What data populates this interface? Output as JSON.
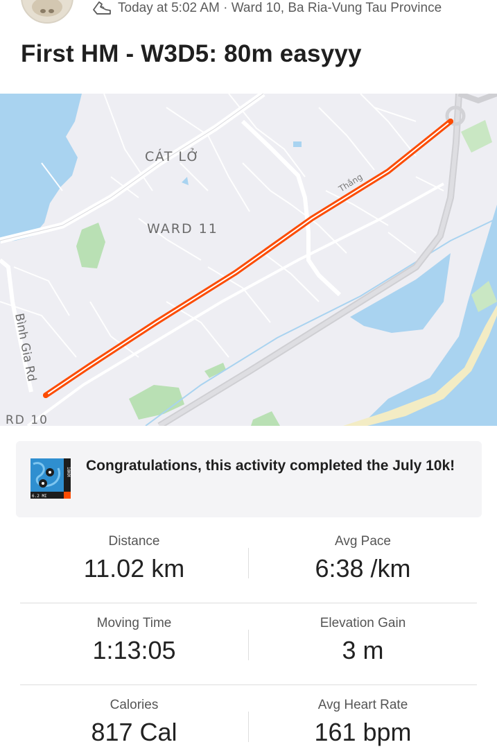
{
  "header": {
    "meta": "Today at 5:02 AM · Ward 10, Ba Ria-Vung Tau Province",
    "title": "First HM - W3D5: 80m easyyy"
  },
  "map": {
    "labels": {
      "cat_lo": "CÁT LỞ",
      "ward_11": "WARD 11",
      "binh_gia": "Bình Gia Rd",
      "ward_10": "RD 10",
      "street_partial": "Thắng"
    },
    "route_color": "#fc4c02",
    "water_color": "#a9d3f0",
    "park_color": "#b9e0b4"
  },
  "challenge": {
    "badge_text_top": "10KM",
    "badge_text_bottom": "6.2 MI",
    "message": "Congratulations, this activity completed the July 10k!"
  },
  "stats": [
    {
      "label": "Distance",
      "value": "11.02 km"
    },
    {
      "label": "Avg Pace",
      "value": "6:38 /km"
    },
    {
      "label": "Moving Time",
      "value": "1:13:05"
    },
    {
      "label": "Elevation Gain",
      "value": "3 m"
    },
    {
      "label": "Calories",
      "value": "817 Cal"
    },
    {
      "label": "Avg Heart Rate",
      "value": "161 bpm"
    }
  ]
}
